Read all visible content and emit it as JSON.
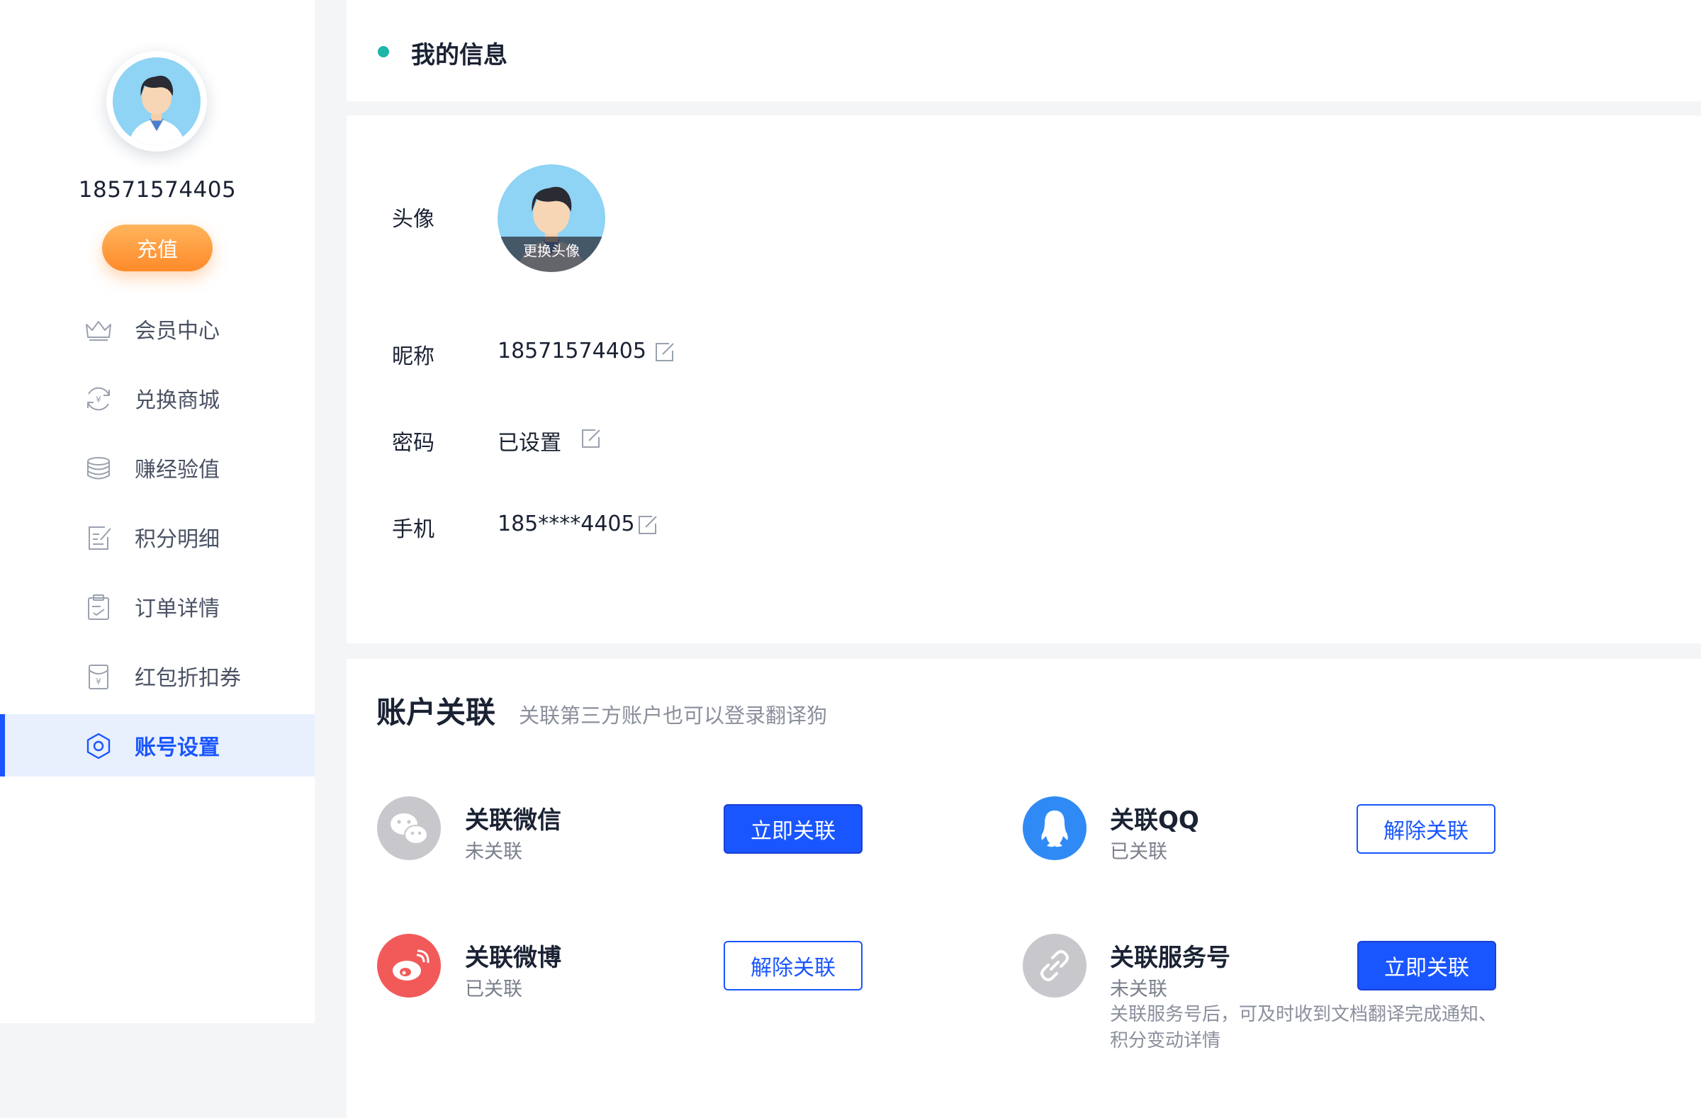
{
  "sidebar": {
    "username": "18571574405",
    "recharge_label": "充值",
    "items": [
      {
        "label": "会员中心",
        "icon": "crown-icon"
      },
      {
        "label": "兑换商城",
        "icon": "exchange-icon"
      },
      {
        "label": "赚经验值",
        "icon": "database-icon"
      },
      {
        "label": "积分明细",
        "icon": "document-edit-icon"
      },
      {
        "label": "订单详情",
        "icon": "clipboard-icon"
      },
      {
        "label": "红包折扣券",
        "icon": "red-packet-icon"
      },
      {
        "label": "账号设置",
        "icon": "settings-hexagon-icon",
        "active": true
      }
    ]
  },
  "header": {
    "title": "我的信息"
  },
  "profile": {
    "avatar_label": "头像",
    "change_avatar_label": "更换头像",
    "nickname_label": "昵称",
    "nickname_value": "18571574405",
    "password_label": "密码",
    "password_value": "已设置",
    "phone_label": "手机",
    "phone_value": "185****4405"
  },
  "accounts": {
    "title": "账户关联",
    "subtitle": "关联第三方账户也可以登录翻译狗",
    "items": [
      {
        "name": "关联微信",
        "status": "未关联",
        "button": "立即关联",
        "icon": "wechat-icon",
        "color": "#c8c8cc"
      },
      {
        "name": "关联QQ",
        "status": "已关联",
        "button": "解除关联",
        "icon": "qq-icon",
        "color": "#2f8af5"
      },
      {
        "name": "关联微博",
        "status": "已关联",
        "button": "解除关联",
        "icon": "weibo-icon",
        "color": "#f25a5a"
      },
      {
        "name": "关联服务号",
        "status": "未关联",
        "button": "立即关联",
        "icon": "link-icon",
        "color": "#c8c8cc",
        "note_line1": "关联服务号后，可及时收到文档翻译完成通知、",
        "note_line2": "积分变动详情"
      }
    ]
  }
}
